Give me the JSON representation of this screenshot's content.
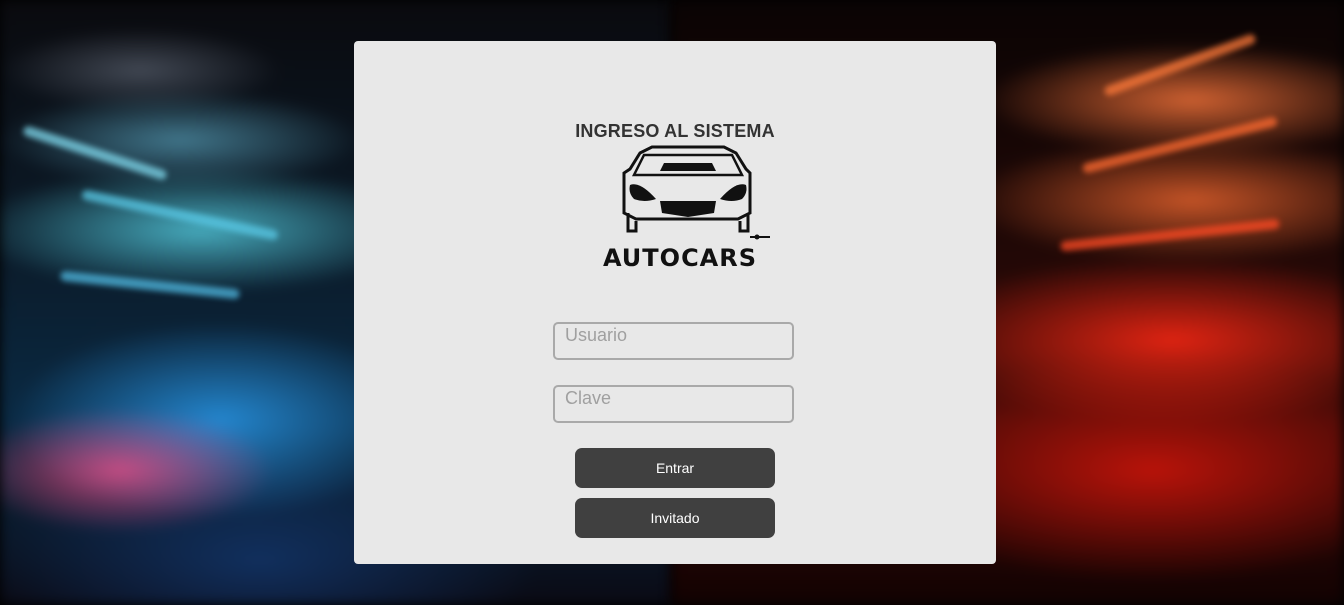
{
  "login": {
    "title": "INGRESO AL SISTEMA",
    "logo": {
      "icon": "car-front-icon",
      "brand": "AUTOCARS"
    },
    "username_placeholder": "Usuario",
    "password_placeholder": "Clave",
    "enter_label": "Entrar",
    "guest_label": "Invitado"
  },
  "colors": {
    "panel_bg": "#e8e8e8",
    "button_bg": "#404040",
    "button_text": "#ffffff",
    "title_text": "#333333"
  }
}
